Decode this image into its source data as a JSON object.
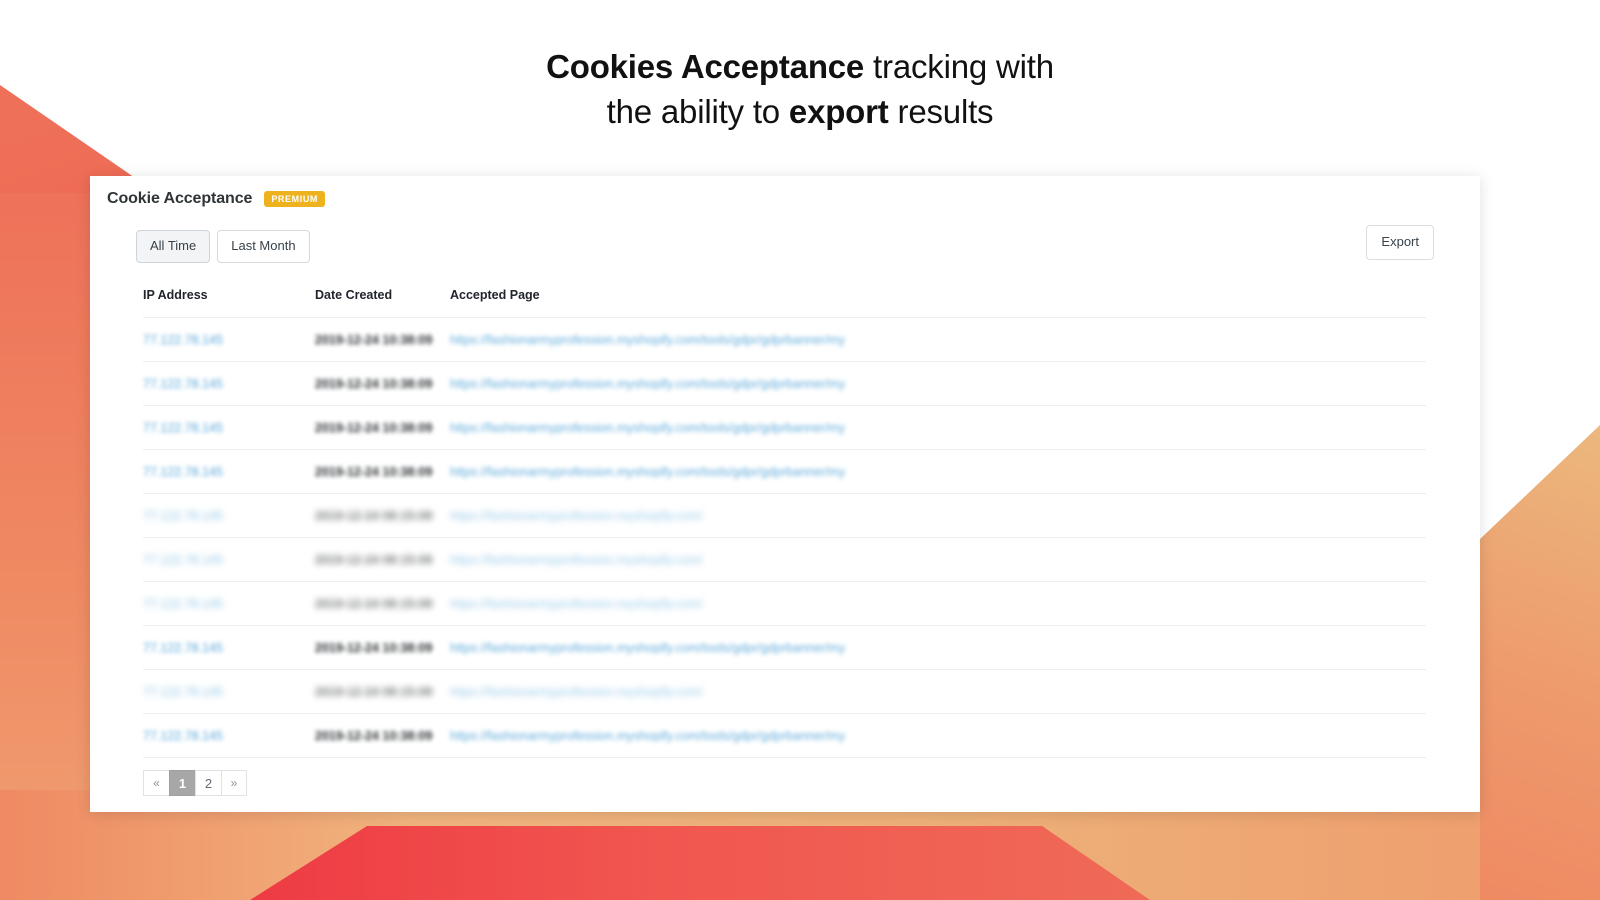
{
  "headline": {
    "line1_strong": "Cookies Acceptance",
    "line1_rest": " tracking with",
    "line2_pre": "the ability to ",
    "line2_strong": "export",
    "line2_post": " results"
  },
  "card": {
    "title": "Cookie Acceptance",
    "badge": "PREMIUM",
    "filters": [
      {
        "label": "All Time",
        "active": true
      },
      {
        "label": "Last Month",
        "active": false
      }
    ],
    "export_label": "Export",
    "table": {
      "columns": [
        "IP Address",
        "Date Created",
        "Accepted Page"
      ],
      "rows": [
        {
          "ip": "77.122.78.145",
          "date": "2019-12-24 10:38:09",
          "page": "https://fashionarmyprofession.myshopify.com/tools/gdpr/gdprbanner/my",
          "blur": "soft"
        },
        {
          "ip": "77.122.78.145",
          "date": "2019-12-24 10:38:09",
          "page": "https://fashionarmyprofession.myshopify.com/tools/gdpr/gdprbanner/my",
          "blur": "soft"
        },
        {
          "ip": "77.122.78.145",
          "date": "2019-12-24 10:38:09",
          "page": "https://fashionarmyprofession.myshopify.com/tools/gdpr/gdprbanner/my",
          "blur": "soft"
        },
        {
          "ip": "77.122.78.145",
          "date": "2019-12-24 10:38:09",
          "page": "https://fashionarmyprofession.myshopify.com/tools/gdpr/gdprbanner/my",
          "blur": "soft"
        },
        {
          "ip": "77.122.78.145",
          "date": "2019-12-24 08:15:08",
          "page": "https://fashionarmyprofession.myshopify.com/",
          "blur": "strong"
        },
        {
          "ip": "77.122.78.145",
          "date": "2019-12-24 08:15:08",
          "page": "https://fashionarmyprofession.myshopify.com/",
          "blur": "strong"
        },
        {
          "ip": "77.122.78.145",
          "date": "2019-12-24 08:15:08",
          "page": "https://fashionarmyprofession.myshopify.com/",
          "blur": "strong"
        },
        {
          "ip": "77.122.78.145",
          "date": "2019-12-24 10:38:09",
          "page": "https://fashionarmyprofession.myshopify.com/tools/gdpr/gdprbanner/my",
          "blur": "soft"
        },
        {
          "ip": "77.122.78.145",
          "date": "2019-12-24 08:15:08",
          "page": "https://fashionarmyprofession.myshopify.com/",
          "blur": "strong"
        },
        {
          "ip": "77.122.78.145",
          "date": "2019-12-24 10:38:09",
          "page": "https://fashionarmyprofession.myshopify.com/tools/gdpr/gdprbanner/my",
          "blur": "soft"
        }
      ]
    },
    "pagination": [
      {
        "label": "«",
        "name": "page-prev",
        "current": false,
        "arrow": true
      },
      {
        "label": "1",
        "name": "page-1",
        "current": true,
        "arrow": false
      },
      {
        "label": "2",
        "name": "page-2",
        "current": false,
        "arrow": false
      },
      {
        "label": "»",
        "name": "page-next",
        "current": false,
        "arrow": true
      }
    ]
  },
  "colors": {
    "badge": "#eeb21e",
    "link": "#5aa8da",
    "coral": "#ee7159",
    "red": "#ee3b44",
    "tan": "#ebb87d",
    "active_page": "#a7a7a7"
  }
}
